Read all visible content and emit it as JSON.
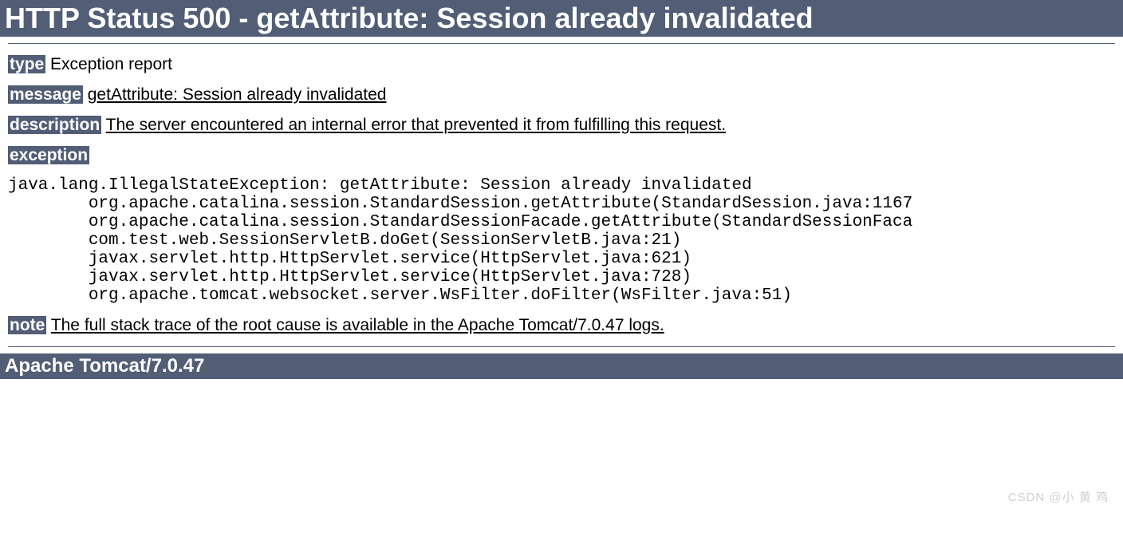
{
  "header": {
    "title": "HTTP Status 500 - getAttribute: Session already invalidated"
  },
  "fields": {
    "type": {
      "label": "type",
      "value": "Exception report"
    },
    "message": {
      "label": "message",
      "value": "getAttribute: Session already invalidated"
    },
    "description": {
      "label": "description",
      "value": "The server encountered an internal error that prevented it from fulfilling this request."
    },
    "exception": {
      "label": "exception"
    },
    "note": {
      "label": "note",
      "value": "The full stack trace of the root cause is available in the Apache Tomcat/7.0.47 logs."
    }
  },
  "stacktrace": "java.lang.IllegalStateException: getAttribute: Session already invalidated\n\torg.apache.catalina.session.StandardSession.getAttribute(StandardSession.java:1167\n\torg.apache.catalina.session.StandardSessionFacade.getAttribute(StandardSessionFaca\n\tcom.test.web.SessionServletB.doGet(SessionServletB.java:21)\n\tjavax.servlet.http.HttpServlet.service(HttpServlet.java:621)\n\tjavax.servlet.http.HttpServlet.service(HttpServlet.java:728)\n\torg.apache.tomcat.websocket.server.WsFilter.doFilter(WsFilter.java:51)",
  "footer": {
    "server": "Apache Tomcat/7.0.47"
  },
  "watermark": "CSDN @小 黄 鸡"
}
